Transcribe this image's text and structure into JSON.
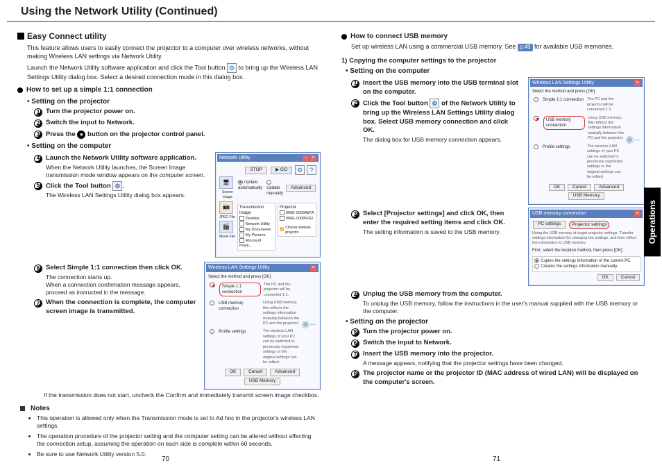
{
  "title": "Using the Network Utility (Continued)",
  "side_tab": "Operations",
  "page_left": "70",
  "page_right": "71",
  "left": {
    "h1": "Easy Connect utility",
    "intro": "This feature allows users to easily connect the projector to a computer over wireless networks, without making Wireless LAN settings via Network Utility.",
    "intro2a": "Launch the Network Utility software application and click the Tool button ",
    "intro2b": " to bring up the Wireless LAN Settings Utility dialog box. Select a desired connection mode in this dialog box.",
    "sub1": "How to set up a simple 1:1 connection",
    "proj_h": "• Setting on the projector",
    "s1": "Turn the projector power on.",
    "s2": "Switch the input to Network.",
    "s3a": "Press the ",
    "s3b": " button on the projector control panel.",
    "comp_h": "• Setting on the computer",
    "s4": "Launch the Network Utility software application.",
    "s4d": "When the Network Utility launches, the Screen Image transmission mode window appears on the computer screen.",
    "s5a": "Click the Tool button ",
    "s5b": ".",
    "s5d": "The Wireless LAN Settings Utility dialog box appears.",
    "s6": "Select Simple 1:1 connection then click OK.",
    "s6d": "The connection starts up.\nWhen a connection confirmation message appears, proceed as instructed in the message.",
    "s7": "When the connection is complete, the computer screen image is transmitted.",
    "s7d": "If the transmission does not start, uncheck the Confirm and immediately transmit screen image checkbox.",
    "notes_h": "Notes",
    "n1": "This operation is allowed only when the Transmission mode is set to Ad hoc in the projector's wireless LAN settings.",
    "n2": "The operation procedure of the projector setting and the computer setting can be altered without affecting the connection setup, assuming the operation on each side is complete within 60 seconds.",
    "n3": "Be sure to use Network Utility version 5.0."
  },
  "right": {
    "h1": "How to connect USB memory",
    "intro_a": "Set up wireless LAN using a commercial USB memory. See ",
    "intro_ref": "p.49",
    "intro_b": " for available USB memories.",
    "copy_h": "1) Copying the computer settings to the projector",
    "comp_h": "• Setting on the computer",
    "s1": "Insert the USB memory into the USB terminal slot on the computer.",
    "s2a": "Click the Tool button ",
    "s2b": " of the Network Utility to bring up the Wireless LAN Settings Utility dialog box. Select USB memory connection and click OK.",
    "s2d": "The dialog box for USB memory connection appears.",
    "s3": "Select [Projector settings] and click OK, then enter the required setting items and click OK.",
    "s3d": "The setting information is saved to the USB memory.",
    "s4": "Unplug the USB memory from the computer.",
    "s4d": "To unplug the USB memory, follow the instructions in the user's manual supplied with the USB memory or the computer.",
    "proj_h": "• Setting on the projector",
    "s5": "Turn the projector power on.",
    "s6": "Switch the input to Network.",
    "s7": "Insert the USB memory into the projector.",
    "s7d": "A message appears, notifying that the projector settings have been changed.",
    "s8": "The projector name or the projector ID (MAC address of wired LAN) will be displayed on the computer's screen."
  },
  "fig1": {
    "title": "Network Utility",
    "stop": "STOP",
    "go": "GO",
    "adv": "Advanced",
    "upd_auto": "Update automatically",
    "upd_man": "Update manually",
    "trans_h": "Transmission Image",
    "proj_h": "Projector",
    "items": [
      "Desktop",
      "Network Utility",
      "My Documents",
      "My Pictures",
      "Microsoft Powe…"
    ],
    "proj_items": [
      "000E-2008A87A",
      "000E-20085F62"
    ],
    "choose": "Choose wireless projector",
    "icon1": "Screen Image",
    "icon2": "JPEG File",
    "icon3": "Movie File"
  },
  "fig2": {
    "title": "Wireless LAN Settings Utility",
    "head": "Select the method and press [OK]",
    "o1": "Simple 1:1 connection",
    "o1d": "The PC and the projector will be connected 1:1.",
    "o2": "USB memory connection",
    "o2d": "Using USB memory, this reflects the settings information mutually between the PC and the projector.",
    "o3": "Profile settings",
    "o3d": "The wireless LAN settings of your PC can be switched to previously registered settings or the original settings can be edited.",
    "ok": "OK",
    "cancel": "Cancel",
    "advb": "Advanced",
    "usbb": "USB Memory"
  },
  "fig4": {
    "title": "USB memory connection",
    "pc": "PC settings",
    "proj": "Projector settings",
    "desc": "Using the USB memory at target projector settings. Transfer settings information for changing the settings, and then reflect the information to USB memory.",
    "first": "First, select the location method, then press [OK].",
    "r1": "Copies the settings information of the current PC.",
    "r2": "Creates the settings information manually.",
    "ok": "OK",
    "cancel": "Cancel"
  }
}
